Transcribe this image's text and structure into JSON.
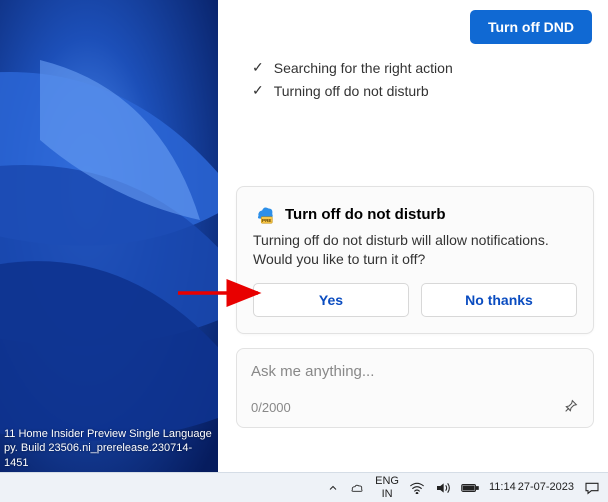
{
  "header": {
    "turn_off_dnd_label": "Turn off DND"
  },
  "status": {
    "items": [
      {
        "label": "Searching for the right action"
      },
      {
        "label": "Turning off do not disturb"
      }
    ]
  },
  "card": {
    "title": "Turn off do not disturb",
    "body": "Turning off do not disturb will allow notifications. Would you like to turn it off?",
    "yes_label": "Yes",
    "no_label": "No thanks"
  },
  "input": {
    "placeholder": "Ask me anything...",
    "value": "",
    "counter": "0/2000"
  },
  "wallpaper": {
    "line1": "11 Home Insider Preview Single Language",
    "line2": "py. Build 23506.ni_prerelease.230714-1451"
  },
  "taskbar": {
    "lang1": "ENG",
    "lang2": "IN",
    "time": "11:14",
    "date": "27-07-2023"
  },
  "annotation": {
    "arrow_target": "yes-button"
  }
}
